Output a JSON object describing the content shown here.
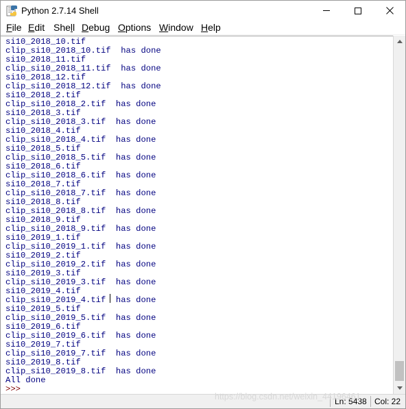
{
  "window": {
    "title": "Python 2.7.14 Shell",
    "app_icon": "python-idle-icon"
  },
  "menu": {
    "items": [
      {
        "pre": "",
        "u": "F",
        "post": "ile"
      },
      {
        "pre": "",
        "u": "E",
        "post": "dit"
      },
      {
        "pre": "She",
        "u": "l",
        "post": "l"
      },
      {
        "pre": "",
        "u": "D",
        "post": "ebug"
      },
      {
        "pre": "",
        "u": "O",
        "post": "ptions"
      },
      {
        "pre": "",
        "u": "W",
        "post": "indow"
      },
      {
        "pre": "",
        "u": "H",
        "post": "elp"
      }
    ]
  },
  "shell": {
    "colors": {
      "output": "#000080",
      "prompt": "#7f0000"
    },
    "lines": [
      "si10_2018_10.tif",
      "clip_si10_2018_10.tif  has done",
      "si10_2018_11.tif",
      "clip_si10_2018_11.tif  has done",
      "si10_2018_12.tif",
      "clip_si10_2018_12.tif  has done",
      "si10_2018_2.tif",
      "clip_si10_2018_2.tif  has done",
      "si10_2018_3.tif",
      "clip_si10_2018_3.tif  has done",
      "si10_2018_4.tif",
      "clip_si10_2018_4.tif  has done",
      "si10_2018_5.tif",
      "clip_si10_2018_5.tif  has done",
      "si10_2018_6.tif",
      "clip_si10_2018_6.tif  has done",
      "si10_2018_7.tif",
      "clip_si10_2018_7.tif  has done",
      "si10_2018_8.tif",
      "clip_si10_2018_8.tif  has done",
      "si10_2018_9.tif",
      "clip_si10_2018_9.tif  has done",
      "si10_2019_1.tif",
      "clip_si10_2019_1.tif  has done",
      "si10_2019_2.tif",
      "clip_si10_2019_2.tif  has done",
      "si10_2019_3.tif",
      "clip_si10_2019_3.tif  has done",
      "si10_2019_4.tif",
      "clip_si10_2019_4.tif  has done",
      "si10_2019_5.tif",
      "clip_si10_2019_5.tif  has done",
      "si10_2019_6.tif",
      "clip_si10_2019_6.tif  has done",
      "si10_2019_7.tif",
      "clip_si10_2019_7.tif  has done",
      "si10_2019_8.tif",
      "clip_si10_2019_8.tif  has done",
      "All done"
    ],
    "prompt": ">>>"
  },
  "status": {
    "ln": "Ln: 5438",
    "col": "Col: 22"
  },
  "watermark": "https://blog.csdn.net/weixin_44196461"
}
